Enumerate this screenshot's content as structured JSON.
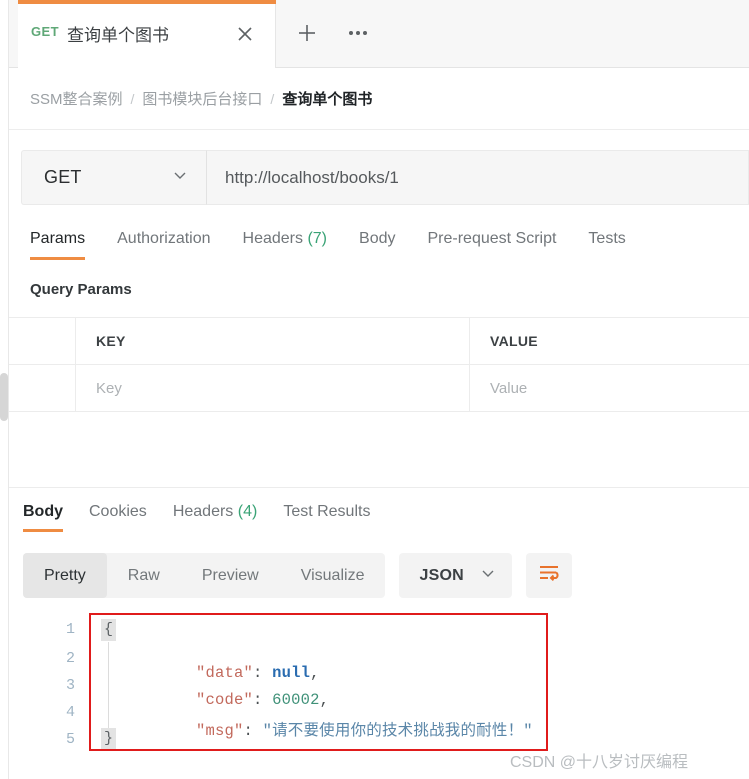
{
  "tab": {
    "method": "GET",
    "title": "查询单个图书",
    "close_icon": "close-icon",
    "new_tab_icon": "plus-icon",
    "more_icon": "ellipsis-icon"
  },
  "breadcrumb": {
    "items": [
      "SSM整合案例",
      "图书模块后台接口",
      "查询单个图书"
    ],
    "separator": "/"
  },
  "request": {
    "method": "GET",
    "url": "http://localhost/books/1",
    "method_caret_icon": "chevron-down-icon",
    "tabs": [
      {
        "label": "Params",
        "count": "",
        "active": true
      },
      {
        "label": "Authorization",
        "count": "",
        "active": false
      },
      {
        "label": "Headers",
        "count": "(7)",
        "active": false
      },
      {
        "label": "Body",
        "count": "",
        "active": false
      },
      {
        "label": "Pre-request Script",
        "count": "",
        "active": false
      },
      {
        "label": "Tests",
        "count": "",
        "active": false
      }
    ],
    "params": {
      "section_title": "Query Params",
      "headers": [
        "KEY",
        "VALUE"
      ],
      "placeholder_row": {
        "key": "Key",
        "value": "Value"
      }
    }
  },
  "response": {
    "tabs": [
      {
        "label": "Body",
        "count": "",
        "active": true
      },
      {
        "label": "Cookies",
        "count": "",
        "active": false
      },
      {
        "label": "Headers",
        "count": "(4)",
        "active": false
      },
      {
        "label": "Test Results",
        "count": "",
        "active": false
      }
    ],
    "view_modes": [
      {
        "label": "Pretty",
        "active": true
      },
      {
        "label": "Raw",
        "active": false
      },
      {
        "label": "Preview",
        "active": false
      },
      {
        "label": "Visualize",
        "active": false
      }
    ],
    "format": "JSON",
    "format_caret_icon": "chevron-down-icon",
    "wrap_icon": "word-wrap-icon",
    "body": {
      "line_numbers": [
        "1",
        "2",
        "3",
        "4",
        "5"
      ],
      "open_brace": "{",
      "close_brace": "}",
      "lines": [
        {
          "key": "\"data\"",
          "colon": ": ",
          "value": "null",
          "type": "null",
          "comma": ","
        },
        {
          "key": "\"code\"",
          "colon": ": ",
          "value": "60002",
          "type": "number",
          "comma": ","
        },
        {
          "key": "\"msg\"",
          "colon": ": ",
          "value": "\"请不要使用你的技术挑战我的耐性！\"",
          "type": "string",
          "comma": ""
        }
      ]
    }
  },
  "annotation": {
    "color": "#e01b1b"
  },
  "watermark": "CSDN @十八岁讨厌编程",
  "colors": {
    "accent_orange": "#ef8c42",
    "method_green": "#5fa877",
    "count_green": "#3aa376",
    "json_key": "#c2695c",
    "json_null": "#2a6cb0",
    "json_number": "#3f9178",
    "json_string": "#5a86a8"
  }
}
